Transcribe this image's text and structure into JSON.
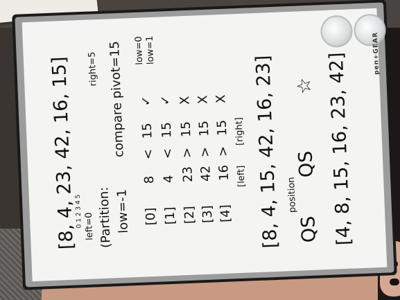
{
  "brand": "pen+GEAR",
  "board_text": {
    "array_original": "[8, 4, 23, 42, 16, 15]",
    "indices": "0   1   2   3   4   5",
    "left": "left=0",
    "right": "right=5",
    "partition": "(Partition:",
    "low_init": "low=-1",
    "compare": "compare pivot=15",
    "low_after_0": "low=0",
    "low_after_1": "low=1",
    "rows": [
      {
        "index": "[0]",
        "value": "8",
        "op": "<",
        "pivot": "15",
        "mark": "✓"
      },
      {
        "index": "[1]",
        "value": "4",
        "op": "<",
        "pivot": "15",
        "mark": "✓"
      },
      {
        "index": "[2]",
        "value": "23",
        "op": ">",
        "pivot": "15",
        "mark": "X"
      },
      {
        "index": "[3]",
        "value": "42",
        "op": ">",
        "pivot": "15",
        "mark": "X"
      },
      {
        "index": "[4]",
        "value": "16",
        "op": ">",
        "pivot": "15",
        "mark": "X"
      }
    ],
    "left_box": "[left]",
    "right_box": "[right]",
    "array_partitioned": "[8, 4, 15, 42, 16, 23]",
    "position_label": "position",
    "qs_left": "QS",
    "qs_right": "QS",
    "star": "☆",
    "array_sorted": "[4, 8, 15, 16, 23, 42]"
  }
}
